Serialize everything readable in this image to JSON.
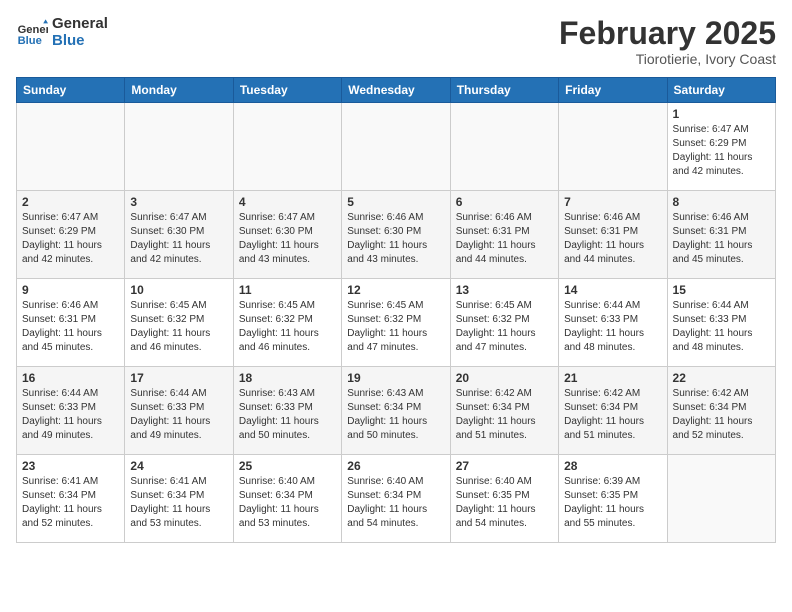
{
  "header": {
    "logo_line1": "General",
    "logo_line2": "Blue",
    "month_year": "February 2025",
    "location": "Tiorotierie, Ivory Coast"
  },
  "days_of_week": [
    "Sunday",
    "Monday",
    "Tuesday",
    "Wednesday",
    "Thursday",
    "Friday",
    "Saturday"
  ],
  "weeks": [
    [
      {
        "day": "",
        "info": ""
      },
      {
        "day": "",
        "info": ""
      },
      {
        "day": "",
        "info": ""
      },
      {
        "day": "",
        "info": ""
      },
      {
        "day": "",
        "info": ""
      },
      {
        "day": "",
        "info": ""
      },
      {
        "day": "1",
        "info": "Sunrise: 6:47 AM\nSunset: 6:29 PM\nDaylight: 11 hours and 42 minutes."
      }
    ],
    [
      {
        "day": "2",
        "info": "Sunrise: 6:47 AM\nSunset: 6:29 PM\nDaylight: 11 hours and 42 minutes."
      },
      {
        "day": "3",
        "info": "Sunrise: 6:47 AM\nSunset: 6:30 PM\nDaylight: 11 hours and 42 minutes."
      },
      {
        "day": "4",
        "info": "Sunrise: 6:47 AM\nSunset: 6:30 PM\nDaylight: 11 hours and 43 minutes."
      },
      {
        "day": "5",
        "info": "Sunrise: 6:46 AM\nSunset: 6:30 PM\nDaylight: 11 hours and 43 minutes."
      },
      {
        "day": "6",
        "info": "Sunrise: 6:46 AM\nSunset: 6:31 PM\nDaylight: 11 hours and 44 minutes."
      },
      {
        "day": "7",
        "info": "Sunrise: 6:46 AM\nSunset: 6:31 PM\nDaylight: 11 hours and 44 minutes."
      },
      {
        "day": "8",
        "info": "Sunrise: 6:46 AM\nSunset: 6:31 PM\nDaylight: 11 hours and 45 minutes."
      }
    ],
    [
      {
        "day": "9",
        "info": "Sunrise: 6:46 AM\nSunset: 6:31 PM\nDaylight: 11 hours and 45 minutes."
      },
      {
        "day": "10",
        "info": "Sunrise: 6:45 AM\nSunset: 6:32 PM\nDaylight: 11 hours and 46 minutes."
      },
      {
        "day": "11",
        "info": "Sunrise: 6:45 AM\nSunset: 6:32 PM\nDaylight: 11 hours and 46 minutes."
      },
      {
        "day": "12",
        "info": "Sunrise: 6:45 AM\nSunset: 6:32 PM\nDaylight: 11 hours and 47 minutes."
      },
      {
        "day": "13",
        "info": "Sunrise: 6:45 AM\nSunset: 6:32 PM\nDaylight: 11 hours and 47 minutes."
      },
      {
        "day": "14",
        "info": "Sunrise: 6:44 AM\nSunset: 6:33 PM\nDaylight: 11 hours and 48 minutes."
      },
      {
        "day": "15",
        "info": "Sunrise: 6:44 AM\nSunset: 6:33 PM\nDaylight: 11 hours and 48 minutes."
      }
    ],
    [
      {
        "day": "16",
        "info": "Sunrise: 6:44 AM\nSunset: 6:33 PM\nDaylight: 11 hours and 49 minutes."
      },
      {
        "day": "17",
        "info": "Sunrise: 6:44 AM\nSunset: 6:33 PM\nDaylight: 11 hours and 49 minutes."
      },
      {
        "day": "18",
        "info": "Sunrise: 6:43 AM\nSunset: 6:33 PM\nDaylight: 11 hours and 50 minutes."
      },
      {
        "day": "19",
        "info": "Sunrise: 6:43 AM\nSunset: 6:34 PM\nDaylight: 11 hours and 50 minutes."
      },
      {
        "day": "20",
        "info": "Sunrise: 6:42 AM\nSunset: 6:34 PM\nDaylight: 11 hours and 51 minutes."
      },
      {
        "day": "21",
        "info": "Sunrise: 6:42 AM\nSunset: 6:34 PM\nDaylight: 11 hours and 51 minutes."
      },
      {
        "day": "22",
        "info": "Sunrise: 6:42 AM\nSunset: 6:34 PM\nDaylight: 11 hours and 52 minutes."
      }
    ],
    [
      {
        "day": "23",
        "info": "Sunrise: 6:41 AM\nSunset: 6:34 PM\nDaylight: 11 hours and 52 minutes."
      },
      {
        "day": "24",
        "info": "Sunrise: 6:41 AM\nSunset: 6:34 PM\nDaylight: 11 hours and 53 minutes."
      },
      {
        "day": "25",
        "info": "Sunrise: 6:40 AM\nSunset: 6:34 PM\nDaylight: 11 hours and 53 minutes."
      },
      {
        "day": "26",
        "info": "Sunrise: 6:40 AM\nSunset: 6:34 PM\nDaylight: 11 hours and 54 minutes."
      },
      {
        "day": "27",
        "info": "Sunrise: 6:40 AM\nSunset: 6:35 PM\nDaylight: 11 hours and 54 minutes."
      },
      {
        "day": "28",
        "info": "Sunrise: 6:39 AM\nSunset: 6:35 PM\nDaylight: 11 hours and 55 minutes."
      },
      {
        "day": "",
        "info": ""
      }
    ]
  ]
}
